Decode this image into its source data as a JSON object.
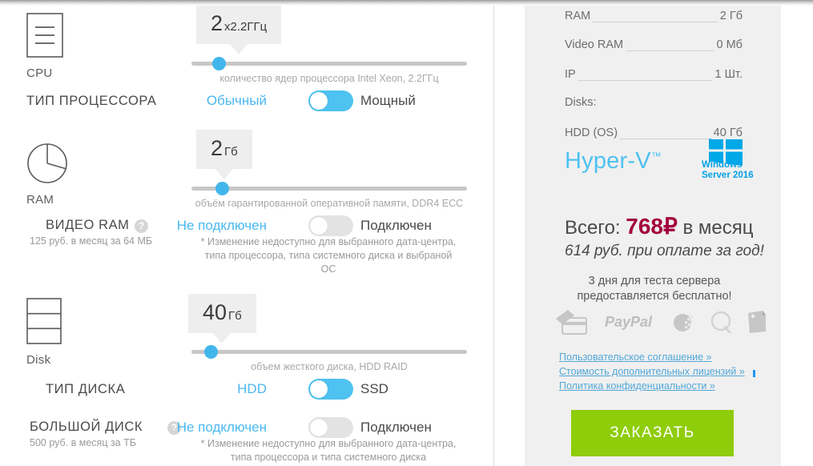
{
  "left": {
    "cpu": {
      "icon": "cpu-chip-icon",
      "icon_label": "CPU",
      "bubble_value": "2",
      "bubble_unit": "x2.2ГГц",
      "slider_hint": "количество ядер процессора Intel Xeon, 2.2ГГц",
      "slider_percent": 10,
      "option_label": "ТИП ПРОЦЕССОРА",
      "toggle_left": "Обычный",
      "toggle_right": "Мощный",
      "toggle_state": "on"
    },
    "ram": {
      "icon": "pie-chart-icon",
      "icon_label": "RAM",
      "bubble_value": "2",
      "bubble_unit": "Гб",
      "slider_hint": "объём гарантированной оперативной памяти, DDR4 ECC",
      "slider_percent": 11,
      "option_label": "ВИДЕО RAM",
      "option_help": "?",
      "option_sub": "125 руб. в месяц за 64 МБ",
      "toggle_left": "Не подключен",
      "toggle_right": "Подключен",
      "toggle_state": "off",
      "note": "* Изменение недоступно для выбранного дата-центра, типа процессора, типа системного диска и выбраной ОС"
    },
    "disk": {
      "icon": "disk-stack-icon",
      "icon_label": "Disk",
      "bubble_value": "40",
      "bubble_unit": "Гб",
      "slider_hint": "объем жесткого диска, HDD RAID",
      "slider_percent": 7,
      "option_label": "ТИП ДИСКА",
      "toggle_left": "HDD",
      "toggle_right": "SSD",
      "toggle_state": "on",
      "big_label": "БОЛЬШОЙ ДИСК",
      "big_help": "?",
      "big_sub": "500 руб. в месяц за ТБ",
      "big_toggle_left": "Не подключен",
      "big_toggle_right": "Подключен",
      "big_toggle_state": "off",
      "big_note": "* Изменение недоступно для выбранного дата-центра, типа процессора и типа системного диска"
    }
  },
  "right": {
    "specs": [
      {
        "name": "RAM",
        "value": "2 Гб",
        "dots": true
      },
      {
        "name": "Video RAM",
        "value": "0 Мб",
        "dots": true
      },
      {
        "name": "IP",
        "value": "1 Шт.",
        "dots": true
      },
      {
        "name": "Disks:",
        "value": "",
        "dots": false
      },
      {
        "name": "HDD (OS)",
        "value": "40 Гб",
        "dots": true
      }
    ],
    "hypervisor": "Hyper-V",
    "hypervisor_tm": "™",
    "windows_line1": "Windows",
    "windows_line2": "Server 2016",
    "total_prefix": "Всего:",
    "total_price": "768₽",
    "total_suffix": "в месяц",
    "yearly": "614 руб. при оплате за год!",
    "free_trial_line1": "3 дня для теста сервера",
    "free_trial_line2": "предоставляется бесплатно!",
    "pay_icons": [
      "credit-card-icon",
      "paypal-icon",
      "webmoney-icon",
      "qiwi-icon",
      "yandex-money-icon"
    ],
    "links": [
      "Пользовательское соглашение »",
      "Стоимость дополнительных лицензий »",
      "Политика конфиденциальности »"
    ],
    "order_button": "ЗАКАЗАТЬ"
  },
  "colors": {
    "accent_blue": "#4ec2f0",
    "price_red": "#a3003c",
    "order_green": "#8fcc0a",
    "panel_gray": "#f0f0f0",
    "link_blue": "#52a7d8"
  }
}
